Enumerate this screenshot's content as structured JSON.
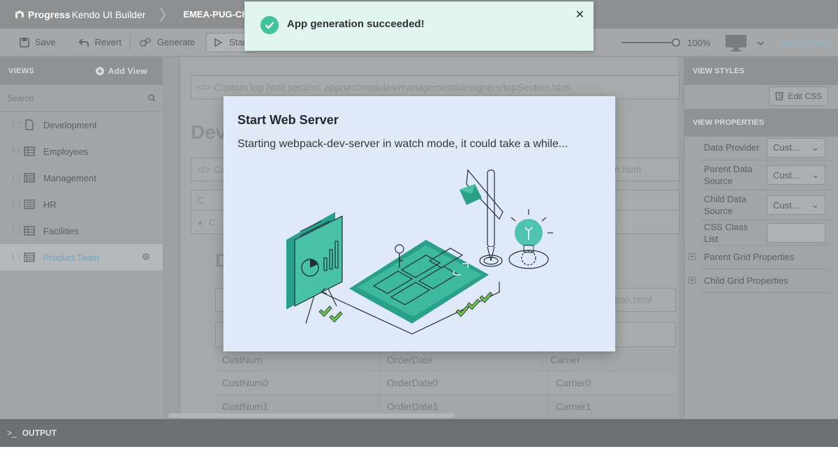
{
  "app": {
    "brand": "Progress",
    "product": "Kendo UI Builder",
    "project": "EMEA-PUG-Cha"
  },
  "toolbar": {
    "save": "Save",
    "revert": "Revert",
    "generate": "Generate",
    "start": "Start",
    "zoom": "100%",
    "help": "Need Help?"
  },
  "views": {
    "header": "VIEWS",
    "add": "Add View",
    "search_placeholder": "Search",
    "items": [
      {
        "label": "Development",
        "icon": "page-icon"
      },
      {
        "label": "Employees",
        "icon": "grid-icon"
      },
      {
        "label": "Management",
        "icon": "master-detail-icon"
      },
      {
        "label": "HR",
        "icon": "form-icon"
      },
      {
        "label": "Facilities",
        "icon": "grid-icon"
      },
      {
        "label": "Product Team",
        "icon": "master-detail-icon",
        "active": true
      }
    ]
  },
  "canvas": {
    "top_section": "</> Custom top html section: app/src/modules/management/designers/topSection.html",
    "title": "Dev",
    "sub_section": "</> Cu",
    "sub_section_tail": "n.html",
    "col_c": "C",
    "title2": "D",
    "section3_tail": "ction.html",
    "grid": {
      "headers": [
        "CustNum",
        "OrderDate",
        "Carrier"
      ],
      "rows": [
        [
          "CustNum0",
          "OrderDate0",
          "Carrier0"
        ],
        [
          "CustNum1",
          "OrderDate1",
          "Carrier1"
        ]
      ]
    }
  },
  "right": {
    "view_styles": "VIEW STYLES",
    "edit_css": "Edit CSS",
    "view_properties": "VIEW PROPERTIES",
    "props": [
      {
        "label": "Data Provider",
        "value": "Cust..."
      },
      {
        "label": "Parent Data Source",
        "value": "Cust..."
      },
      {
        "label": "Child Data Source",
        "value": "Cust..."
      },
      {
        "label": "CSS Class List",
        "value": ""
      }
    ],
    "groups": [
      "Parent Grid Properties",
      "Child Grid Properties"
    ]
  },
  "output": {
    "label": "OUTPUT"
  },
  "toast": {
    "message": "App generation succeeded!"
  },
  "modal": {
    "title": "Start Web Server",
    "text": "Starting webpack-dev-server in watch mode, it could take a while..."
  },
  "colors": {
    "accent": "#6fa7c3",
    "success": "#3fc49e",
    "modal_bg": "#dfe9f7"
  }
}
